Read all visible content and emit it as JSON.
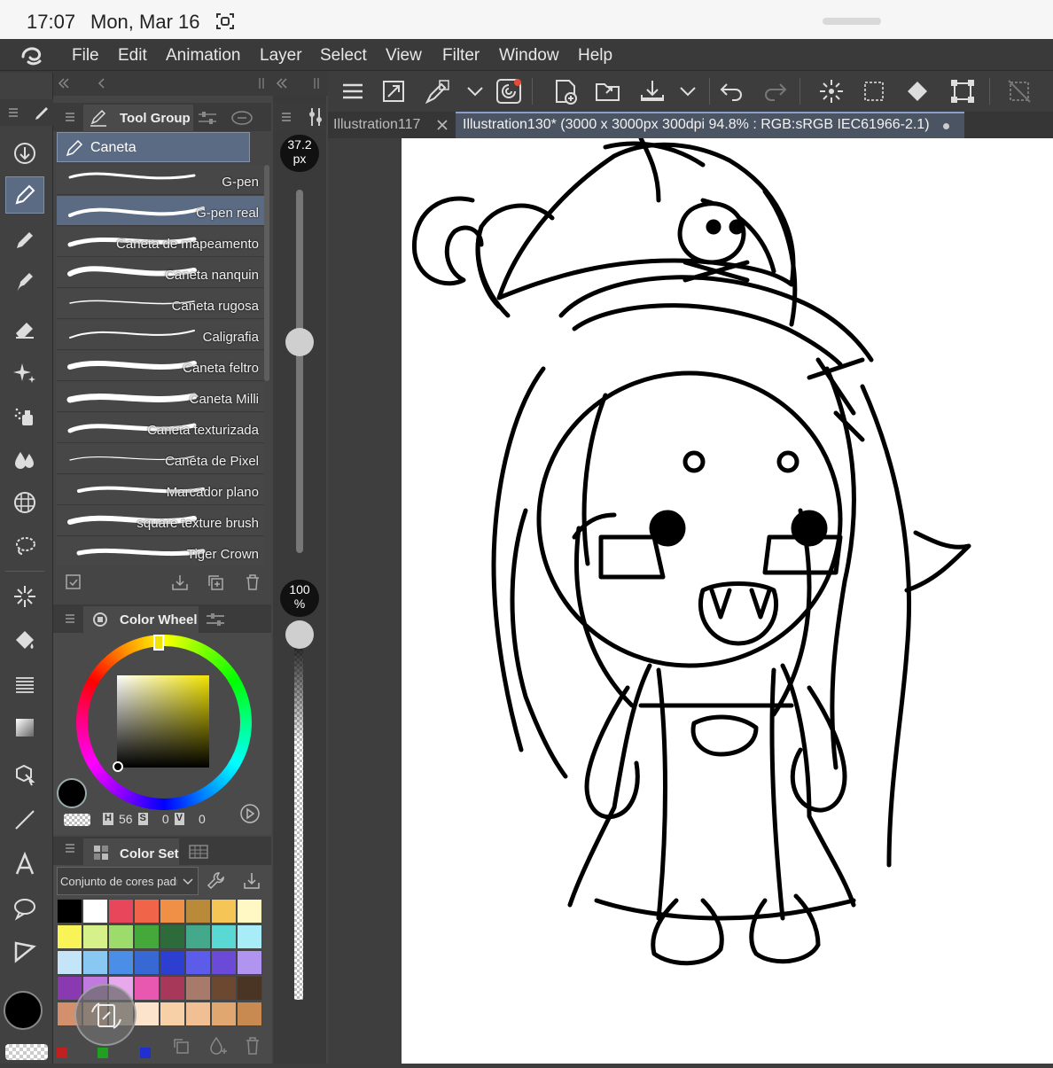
{
  "status": {
    "time": "17:07",
    "date": "Mon, Mar 16"
  },
  "menu": [
    "File",
    "Edit",
    "Animation",
    "Layer",
    "Select",
    "View",
    "Filter",
    "Window",
    "Help"
  ],
  "tabs": [
    {
      "label": "Illustration117"
    },
    {
      "label": "Illustration130* (3000 x 3000px 300dpi 94.8% : RGB:sRGB IEC61966-2.1)"
    }
  ],
  "tool_group": {
    "title": "Tool Group",
    "selected": "Caneta",
    "brushes": [
      "G-pen",
      "G-pen real",
      "Caneta de mapeamento",
      "Caneta nanquin",
      "Caneta rugosa",
      "Caligrafia",
      "Caneta feltro",
      "Caneta Milli",
      "Caneta texturizada",
      "Caneta de Pixel",
      "Marcador plano",
      "square texture brush",
      "Tiger Crown"
    ],
    "selected_brush": "G-pen real"
  },
  "brush_size": {
    "value": "37.2",
    "unit": "px",
    "level": 0.58
  },
  "opacity": {
    "value": "100",
    "unit": "%",
    "level": 1.0
  },
  "color_wheel": {
    "title": "Color Wheel",
    "h_label": "H",
    "h": "56",
    "s_label": "S",
    "s": "0",
    "v_label": "V",
    "v": "0",
    "main_color": "#000000",
    "square_hue_color": "#f2e400"
  },
  "color_set": {
    "title": "Color Set",
    "dropdown": "Conjunto de cores padrã",
    "colors": [
      "#000000",
      "#ffffff",
      "#e8465a",
      "#f0654a",
      "#f08f46",
      "#b88a3a",
      "#f5c655",
      "#fff8c4",
      "#f8f458",
      "#d6f08a",
      "#9ddc6a",
      "#45a83a",
      "#2e6b3a",
      "#44a88a",
      "#5ad8d4",
      "#a8ecf8",
      "#c4e4f8",
      "#8ac8f4",
      "#4a8ee8",
      "#3868d4",
      "#2c3fd0",
      "#5c5cea",
      "#6b4ad8",
      "#b094f0",
      "#8a3ab0",
      "#c07ae0",
      "#e8a8ec",
      "#e858b0",
      "#a8385a",
      "#a87a6c",
      "#6c4830",
      "#4a3424",
      "#d4906c",
      "#e8b48c",
      "#f0d4b4",
      "#fce4cc",
      "#f8d0a8",
      "#f0c094",
      "#e0a870",
      "#c88a50"
    ]
  }
}
